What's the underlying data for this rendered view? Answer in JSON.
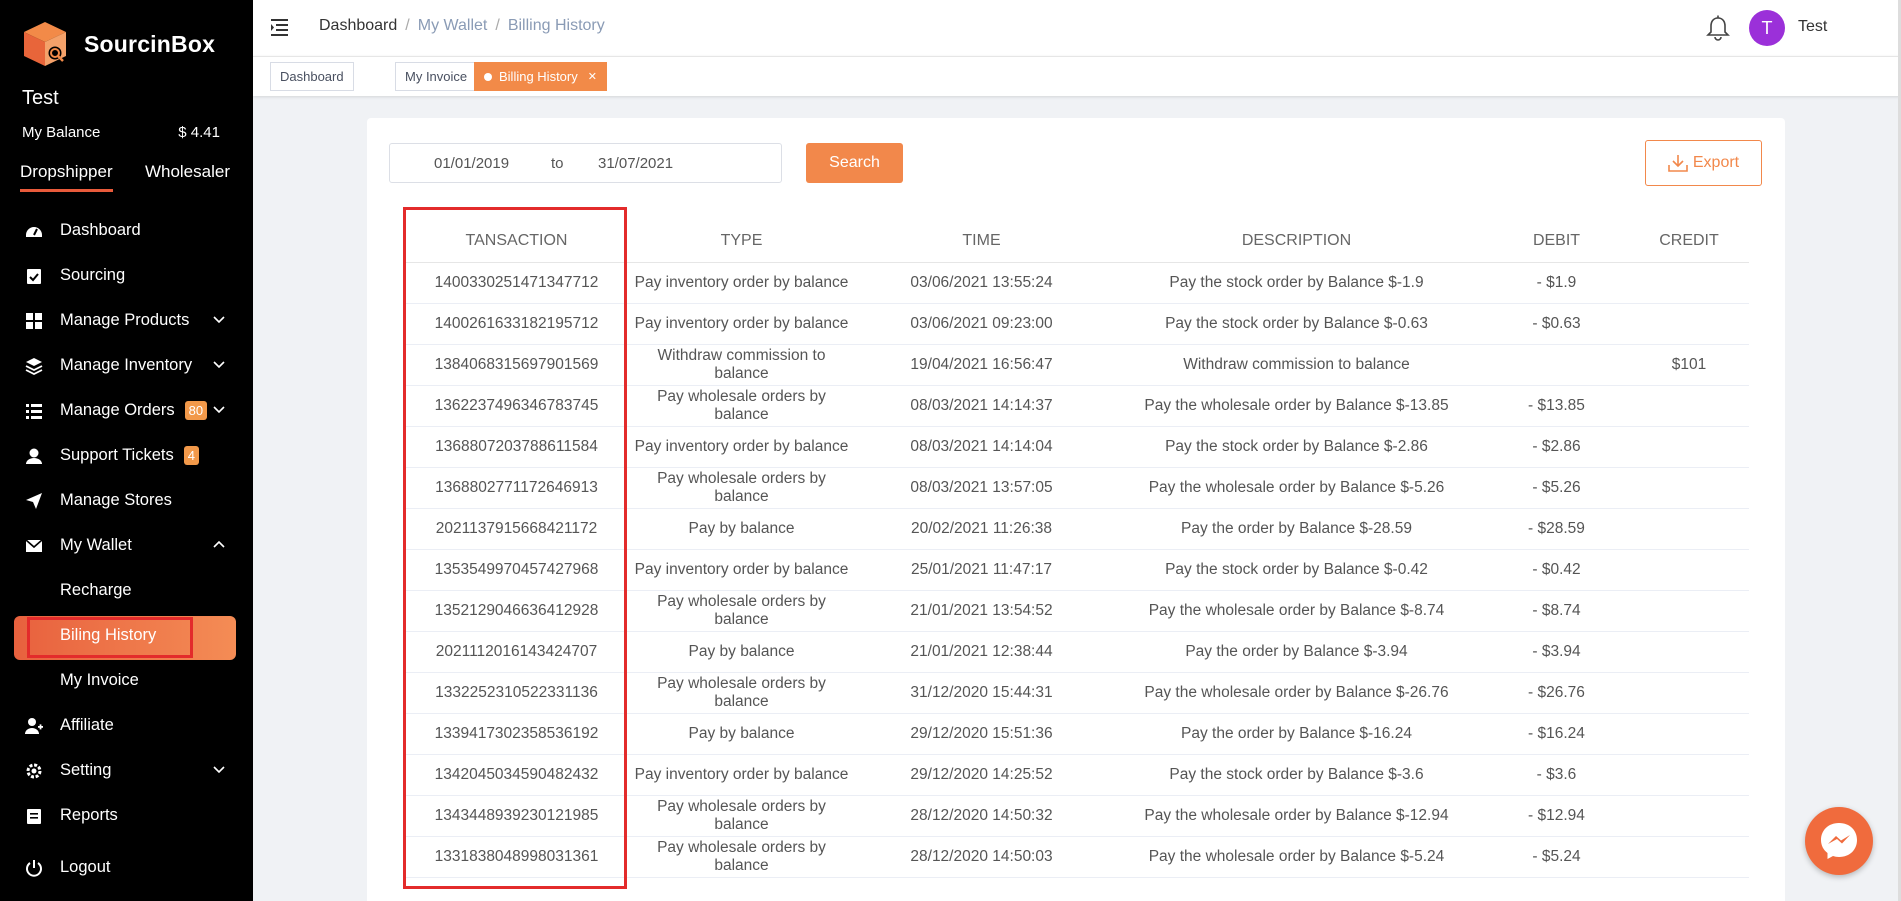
{
  "brand": {
    "name": "SourcinBox"
  },
  "sidebar": {
    "user_name": "Test",
    "balance_label": "My Balance",
    "balance_value": "$ 4.41",
    "role_tabs": [
      "Dropshipper",
      "Wholesaler"
    ],
    "items": [
      {
        "label": "Dashboard",
        "icon": "dashboard-icon"
      },
      {
        "label": "Sourcing",
        "icon": "clipboard-icon"
      },
      {
        "label": "Manage Products",
        "icon": "grid-icon"
      },
      {
        "label": "Manage Inventory",
        "icon": "layers-icon"
      },
      {
        "label": "Manage Orders",
        "icon": "list-icon",
        "badge": "80"
      },
      {
        "label": "Support Tickets",
        "icon": "support-icon",
        "badge": "4"
      },
      {
        "label": "Manage Stores",
        "icon": "send-icon"
      },
      {
        "label": "My Wallet",
        "icon": "mail-icon"
      },
      {
        "label": "Recharge"
      },
      {
        "label": "Biling History"
      },
      {
        "label": "My Invoice"
      },
      {
        "label": "Affiliate",
        "icon": "user-plus-icon"
      },
      {
        "label": "Setting",
        "icon": "gear-icon"
      },
      {
        "label": "Reports",
        "icon": "report-icon"
      }
    ],
    "logout": "Logout"
  },
  "header": {
    "breadcrumb": [
      "Dashboard",
      "My Wallet",
      "Billing History"
    ],
    "separator": "/",
    "avatar_letter": "T",
    "user": "Test"
  },
  "tags": [
    "Dashboard",
    "My Invoice",
    "Billing History"
  ],
  "filters": {
    "date_from": "01/01/2019",
    "to_label": "to",
    "date_to": "31/07/2021",
    "search_label": "Search",
    "export_label": "Export"
  },
  "table": {
    "columns": [
      "TANSACTION",
      "TYPE",
      "TIME",
      "DESCRIPTION",
      "DEBIT",
      "CREDIT"
    ],
    "rows": [
      [
        "1400330251471347712",
        "Pay inventory order by balance",
        "03/06/2021 13:55:24",
        "Pay the stock order by Balance $-1.9",
        "- $1.9",
        ""
      ],
      [
        "1400261633182195712",
        "Pay inventory order by balance",
        "03/06/2021 09:23:00",
        "Pay the stock order by Balance $-0.63",
        "- $0.63",
        ""
      ],
      [
        "1384068315697901569",
        "Withdraw commission to balance",
        "19/04/2021 16:56:47",
        "Withdraw commission to balance",
        "",
        "$101"
      ],
      [
        "1362237496346783745",
        "Pay wholesale orders by balance",
        "08/03/2021 14:14:37",
        "Pay the wholesale order by Balance $-13.85",
        "- $13.85",
        ""
      ],
      [
        "1368807203788611584",
        "Pay inventory order by balance",
        "08/03/2021 14:14:04",
        "Pay the stock order by Balance $-2.86",
        "- $2.86",
        ""
      ],
      [
        "1368802771172646913",
        "Pay wholesale orders by balance",
        "08/03/2021 13:57:05",
        "Pay the wholesale order by Balance $-5.26",
        "- $5.26",
        ""
      ],
      [
        "2021137915668421172",
        "Pay by balance",
        "20/02/2021 11:26:38",
        "Pay the order by Balance $-28.59",
        "- $28.59",
        ""
      ],
      [
        "1353549970457427968",
        "Pay inventory order by balance",
        "25/01/2021 11:47:17",
        "Pay the stock order by Balance $-0.42",
        "- $0.42",
        ""
      ],
      [
        "1352129046636412928",
        "Pay wholesale orders by balance",
        "21/01/2021 13:54:52",
        "Pay the wholesale order by Balance $-8.74",
        "- $8.74",
        ""
      ],
      [
        "2021112016143424707",
        "Pay by balance",
        "21/01/2021 12:38:44",
        "Pay the order by Balance $-3.94",
        "- $3.94",
        ""
      ],
      [
        "1332252310522331136",
        "Pay wholesale orders by balance",
        "31/12/2020 15:44:31",
        "Pay the wholesale order by Balance $-26.76",
        "- $26.76",
        ""
      ],
      [
        "1339417302358536192",
        "Pay by balance",
        "29/12/2020 15:51:36",
        "Pay the order by Balance $-16.24",
        "- $16.24",
        ""
      ],
      [
        "1342045034590482432",
        "Pay inventory order by balance",
        "29/12/2020 14:25:52",
        "Pay the stock order by Balance $-3.6",
        "- $3.6",
        ""
      ],
      [
        "1343448939230121985",
        "Pay wholesale orders by balance",
        "28/12/2020 14:50:32",
        "Pay the wholesale order by Balance $-12.94",
        "- $12.94",
        ""
      ],
      [
        "1331838048998031361",
        "Pay wholesale orders by balance",
        "28/12/2020 14:50:03",
        "Pay the wholesale order by Balance $-5.24",
        "- $5.24",
        ""
      ]
    ]
  },
  "colors": {
    "accent": "#f2884b",
    "sidebar_bg": "#000000",
    "highlight": "#e32b2b",
    "avatar": "#9b30d9"
  }
}
